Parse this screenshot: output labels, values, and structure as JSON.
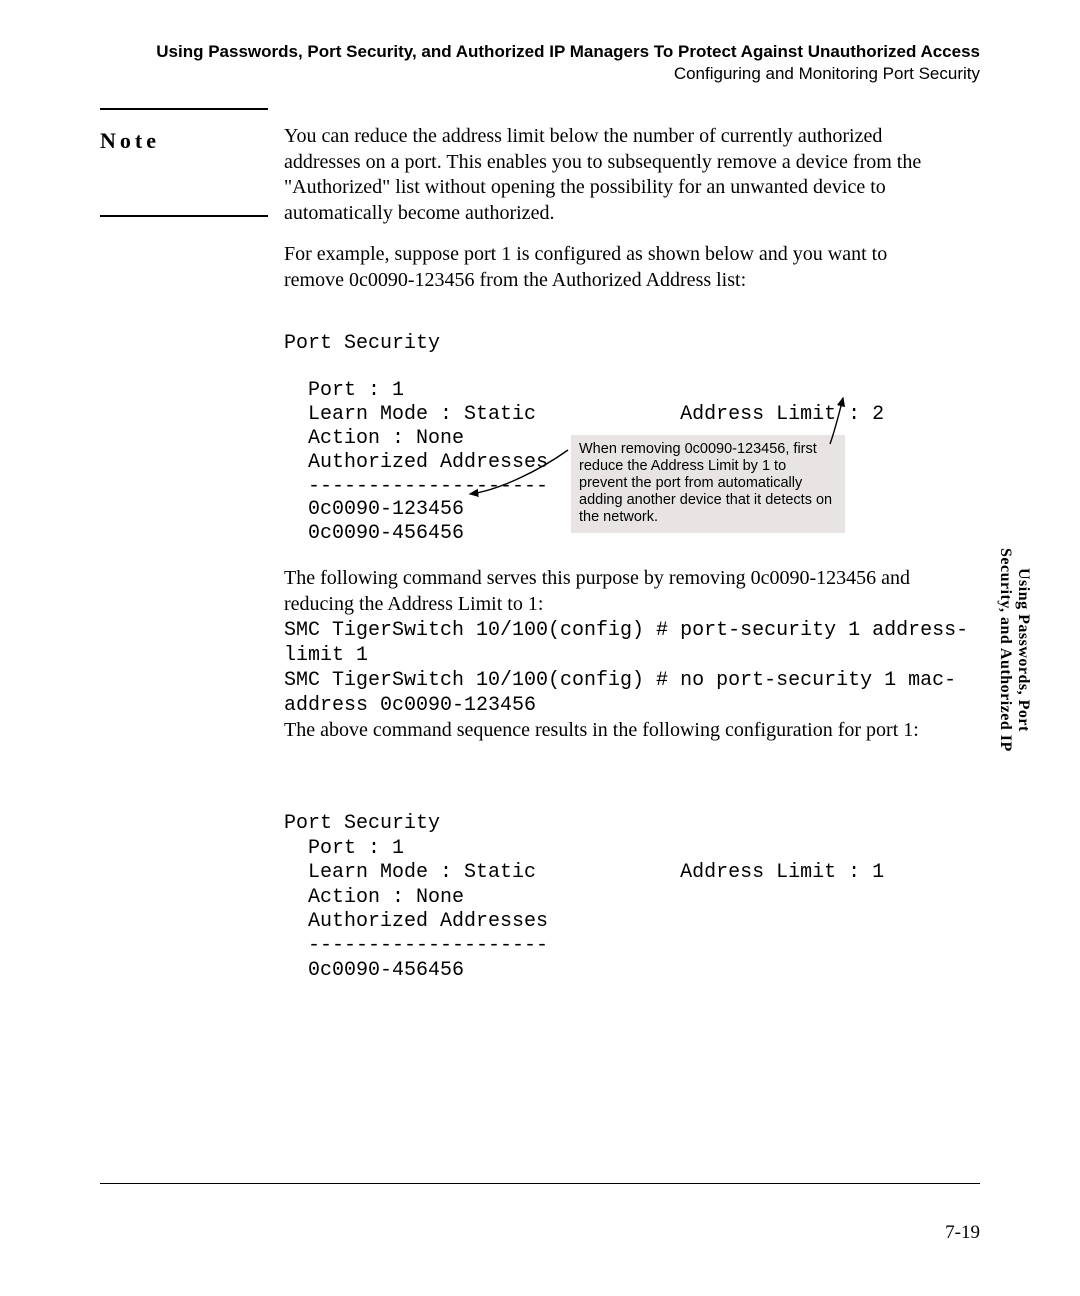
{
  "header": {
    "line1": "Using Passwords, Port Security, and Authorized IP Managers To Protect Against Unauthorized Access",
    "line2": "Configuring and Monitoring Port Security"
  },
  "note_label": "Note",
  "paragraphs": {
    "p1": "You can reduce the address limit below the number of currently authorized addresses on a port. This enables you to subsequently remove a device from the \"Authorized\" list without opening the possibility for an unwanted device to automatically become authorized.",
    "p2": "For example, suppose port 1 is configured as shown below and you want to remove 0c0090-123456 from the Authorized Address list:",
    "p3": "The following command serves this purpose by removing 0c0090-123456 and reducing the Address Limit to 1:",
    "p4": "The above command sequence results in the following configuration for port 1:"
  },
  "figure1": {
    "title": "Port Security",
    "port_line": "  Port : 1",
    "learn_line": "  Learn Mode : Static            Address Limit : 2",
    "action_line": "  Action : None",
    "auth_header": "  Authorized Addresses",
    "auth_divider": "  --------------------",
    "addr1": "  0c0090-123456",
    "addr2": "  0c0090-456456"
  },
  "callout_text": "When removing 0c0090-123456, first reduce the Address Limit by 1 to prevent the port from automatically adding another device that it detects on the network.",
  "code": {
    "line1": "SMC TigerSwitch 10/100(config) # port-security 1 address-",
    "line2": "limit 1",
    "line3": "SMC TigerSwitch 10/100(config) # no port-security 1 mac-",
    "line4": "address 0c0090-123456"
  },
  "figure2": {
    "title": "Port Security",
    "port_line": "  Port : 1",
    "learn_line": "  Learn Mode : Static            Address Limit : 1",
    "action_line": "  Action : None",
    "auth_header": "  Authorized Addresses",
    "auth_divider": "  --------------------",
    "addr1": "  0c0090-456456"
  },
  "side_tab": {
    "line1": "Using Passwords, Port",
    "line2": "Security, and Authorized IP"
  },
  "page_number": "7-19"
}
